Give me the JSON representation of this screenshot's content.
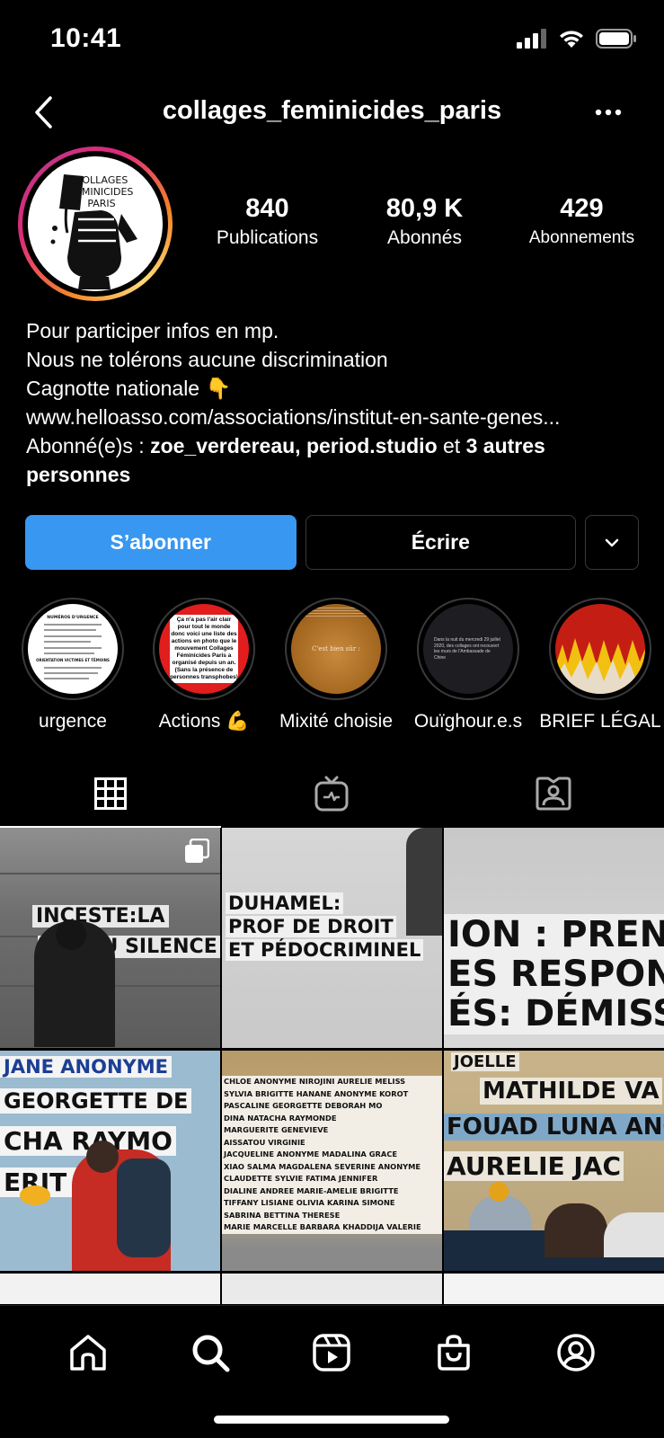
{
  "status_bar": {
    "time": "10:41"
  },
  "header": {
    "username": "collages_feminicides_paris"
  },
  "profile": {
    "avatar_text": [
      "COLLAGES",
      "FÉMINICIDES",
      "PARIS"
    ],
    "stats": [
      {
        "value": "840",
        "label": "Publications"
      },
      {
        "value": "80,9 K",
        "label": "Abonnés"
      },
      {
        "value": "429",
        "label": "Abonnements"
      }
    ],
    "bio": {
      "line1": "Pour participer infos en mp.",
      "line2": "Nous ne tolérons aucune discrimination",
      "line3": "Cagnotte nationale 👇",
      "link": "www.helloasso.com/associations/institut-en-sante-genes...",
      "followed_prefix": "Abonné(e)s : ",
      "followed_users": "zoe_verdereau, period.studio",
      "followed_and": " et ",
      "followed_others": "3 autres personnes"
    }
  },
  "buttons": {
    "follow": "S’abonner",
    "message": "Écrire"
  },
  "highlights": [
    {
      "label": "urgence",
      "preview_title": "NUMÉROS D'URGENCE",
      "preview_sub": "ORIENTATION VICTIMES ET TÉMOINS"
    },
    {
      "label": "Actions 💪",
      "preview_text": "Ça n'a pas l'air clair pour tout le monde donc voici une liste des actions en photo que le mouvement Collages Féminicides Paris a organisé depuis un an. (Sans la présence de personnes transphobes)"
    },
    {
      "label": "Mixité choisie",
      "preview_text": "C'est bien sûr :"
    },
    {
      "label": "Ouïghour.e.s",
      "preview_text": "Dans la nuit du mercredi 29 juillet 2020, des collages ont recouvert les murs de l'Ambassade de Chine"
    },
    {
      "label": "BRIEF LÉGAL"
    }
  ],
  "posts": [
    {
      "lines": [
        "INCESTE:LA",
        "FIN DU SILENCE"
      ]
    },
    {
      "lines": [
        "DUHAMEL:",
        "PROF DE DROIT",
        "ET PÉDOCRIMINEL"
      ]
    },
    {
      "lines": [
        "ION : PREN",
        "ES RESPONS",
        "ÉS: DÉMISS"
      ]
    },
    {
      "lines": [
        "JANE ANONYME",
        "GEORGETTE DE",
        "CHA  RAYMO",
        "ERIT   GE"
      ]
    },
    {
      "lines": [
        "CHLOE ANONYME NIROJINI AURELIE MELISS",
        "SYLVIA BRIGITTE HANANE ANONYME KOROT",
        "PASCALINE GEORGETTE DEBORAH MO",
        "DINA NATACHA RAYMONDE",
        "MARGUERITE GENEVIEVE",
        "AISSATOU VIRGINIE",
        "JACQUELINE ANONYME MADALINA GRACE",
        "XIAO SALMA MAGDALENA SEVERINE ANONYME",
        "CLAUDETTE SYLVIE FATIMA JENNIFER",
        "DIALINE ANDREE MARIE-AMELIE BRIGITTE",
        "TIFFANY LISIANE OLIVIA KARINA SIMONE",
        "SABRINA BETTINA THERESE",
        "MARIE MARCELLE BARBARA KHADDIJA VALERIE"
      ]
    },
    {
      "lines": [
        "JOELLE",
        "MATHILDE VA",
        "FOUAD LUNA ANON",
        "AURELIE JAC"
      ]
    }
  ]
}
